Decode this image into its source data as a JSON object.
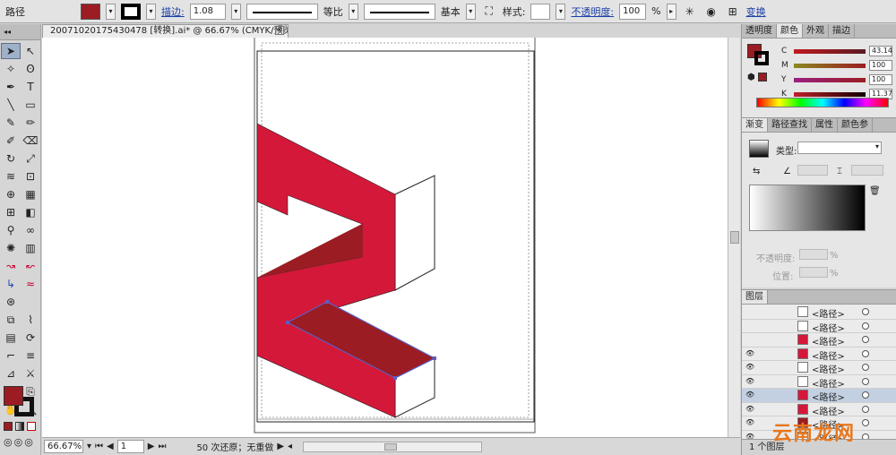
{
  "control_bar": {
    "object_type": "路径",
    "fill_color": "#9b1c22",
    "stroke_label": "描边:",
    "stroke_weight": "1.08 ",
    "profile_label": "等比",
    "brush_label": "基本",
    "style_label": "样式:",
    "opacity_label": "不透明度:",
    "opacity_value": "100",
    "opacity_unit": "%",
    "transform_label": "变换"
  },
  "document": {
    "tab_title": "20071020175430478 [转换].ai* @ 66.67% (CMYK/预览)"
  },
  "artwork": {
    "red": "#d4183a",
    "dark_red": "#9b1c22",
    "selection": "#5a5fc4"
  },
  "status": {
    "zoom": "66.67%",
    "artboard": "1",
    "history": "50 次还原；无重做"
  },
  "color_panel": {
    "tabs": [
      "透明度",
      "颜色",
      "外观",
      "描边"
    ],
    "active_tab": "颜色",
    "channels": [
      {
        "label": "C",
        "value": "43.14"
      },
      {
        "label": "M",
        "value": "100"
      },
      {
        "label": "Y",
        "value": "100"
      },
      {
        "label": "K",
        "value": "11.37"
      }
    ],
    "unit": "%"
  },
  "gradient_panel": {
    "tabs": [
      "渐变",
      "路径查找",
      "属性",
      "颜色参"
    ],
    "type_label": "类型:",
    "opacity_label": "不透明度:",
    "location_label": "位置:",
    "unit": "%"
  },
  "layers_panel": {
    "title": "图层",
    "rows": [
      "<路径>",
      "<路径>",
      "<路径>",
      "<路径>",
      "<路径>",
      "<路径>",
      "<路径>",
      "<路径>",
      "<路径>",
      "<路径>"
    ],
    "footer": "1 个图层"
  },
  "watermark": "云南龙网"
}
